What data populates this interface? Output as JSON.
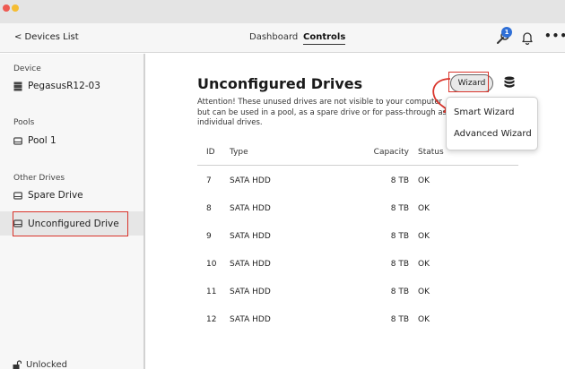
{
  "nav": {
    "back_label": "< Devices List",
    "tabs": [
      {
        "label": "Dashboard",
        "active": false
      },
      {
        "label": "Controls",
        "active": true
      }
    ],
    "notification_count": "1",
    "more_label": "•••"
  },
  "sidebar": {
    "device_heading": "Device",
    "device_name": "PegasusR12-03",
    "pools_heading": "Pools",
    "pool_name": "Pool 1",
    "other_heading": "Other Drives",
    "spare_label": "Spare Drive",
    "unconfigured_label": "Unconfigured Drive",
    "lock_label": "Unlocked"
  },
  "main": {
    "title": "Unconfigured Drives",
    "description": "Attention! These unused drives are not visible to your computer but can be used in a pool, as a spare drive or for pass-through as individual drives.",
    "wizard_label": "Wizard",
    "menu": [
      "Smart Wizard",
      "Advanced Wizard"
    ],
    "columns": [
      "ID",
      "Type",
      "Capacity",
      "Status"
    ],
    "rows": [
      {
        "id": "7",
        "type": "SATA HDD",
        "capacity": "8 TB",
        "status": "OK"
      },
      {
        "id": "8",
        "type": "SATA HDD",
        "capacity": "8 TB",
        "status": "OK"
      },
      {
        "id": "9",
        "type": "SATA HDD",
        "capacity": "8 TB",
        "status": "OK"
      },
      {
        "id": "10",
        "type": "SATA HDD",
        "capacity": "8 TB",
        "status": "OK"
      },
      {
        "id": "11",
        "type": "SATA HDD",
        "capacity": "8 TB",
        "status": "OK"
      },
      {
        "id": "12",
        "type": "SATA HDD",
        "capacity": "8 TB",
        "status": "OK"
      }
    ]
  },
  "colors": {
    "highlight": "#d9342b",
    "badge": "#2f6fd6",
    "selected_bg": "#e6e6e6"
  },
  "icons": [
    "server-icon",
    "drive-icon",
    "wrench-icon",
    "bell-icon",
    "database-icon",
    "lock-open-icon",
    "arrow-icon"
  ]
}
